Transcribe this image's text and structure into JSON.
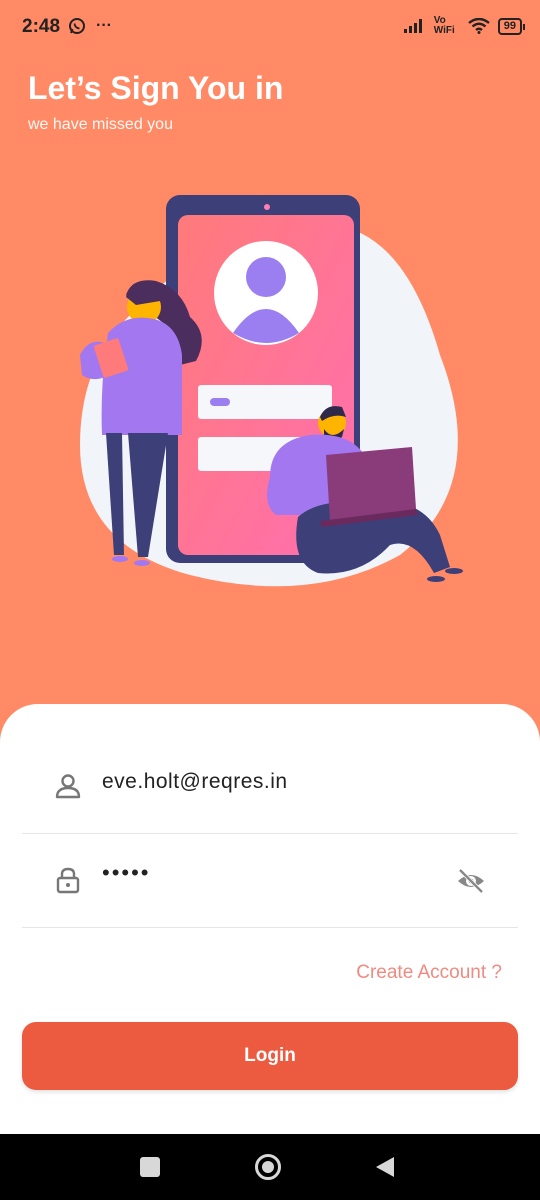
{
  "status": {
    "time": "2:48",
    "whatsapp_icon": "whatsapp-icon",
    "more_notifications": "···",
    "network": "Vo WiFi",
    "battery": "99"
  },
  "header": {
    "title": "Let’s Sign You in",
    "subtitle": "we have missed you"
  },
  "form": {
    "email": {
      "icon": "person-icon",
      "value": "eve.holt@reqres.in"
    },
    "password": {
      "icon": "lock-icon",
      "value": "•••••",
      "toggle_icon": "eye-off-icon"
    },
    "create_account_label": "Create Account ?",
    "login_label": "Login"
  },
  "colors": {
    "background": "#ff8a65",
    "button": "#ec5a40",
    "link": "#f08a80"
  }
}
